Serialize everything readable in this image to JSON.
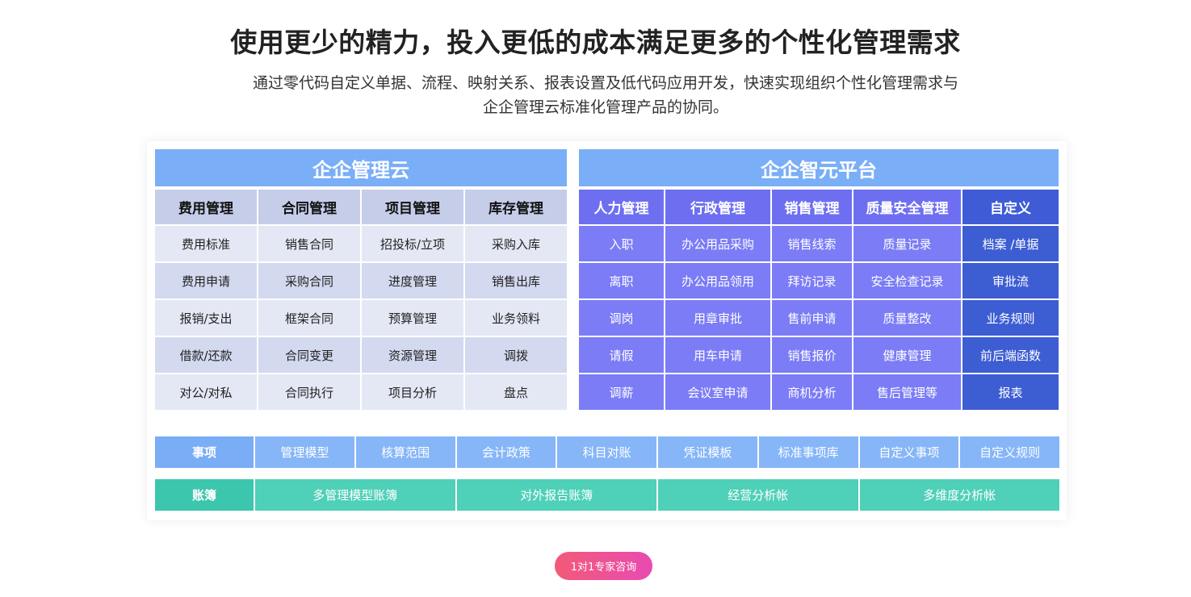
{
  "header": {
    "title": "使用更少的精力，投入更低的成本满足更多的个性化管理需求",
    "subtitle": "通过零代码自定义单据、流程、映射关系、报表设置及低代码应用开发，快速实现组织个性化管理需求与企企管理云标准化管理产品的协同。"
  },
  "left_block": {
    "title": "企企管理云",
    "columns": [
      "费用管理",
      "合同管理",
      "项目管理",
      "库存管理"
    ],
    "rows": [
      [
        "费用标准",
        "销售合同",
        "招投标/立项",
        "采购入库"
      ],
      [
        "费用申请",
        "采购合同",
        "进度管理",
        "销售出库"
      ],
      [
        "报销/支出",
        "框架合同",
        "预算管理",
        "业务领料"
      ],
      [
        "借款/还款",
        "合同变更",
        "资源管理",
        "调拨"
      ],
      [
        "对公/对私",
        "合同执行",
        "项目分析",
        "盘点"
      ]
    ]
  },
  "right_block": {
    "title": "企企智元平台",
    "columns": [
      "人力管理",
      "行政管理",
      "销售管理",
      "质量安全管理",
      "自定义"
    ],
    "rows": [
      [
        "入职",
        "办公用品采购",
        "销售线索",
        "质量记录",
        "档案 /单据"
      ],
      [
        "离职",
        "办公用品领用",
        "拜访记录",
        "安全检查记录",
        "审批流"
      ],
      [
        "调岗",
        "用章审批",
        "售前申请",
        "质量整改",
        "业务规则"
      ],
      [
        "请假",
        "用车申请",
        "销售报价",
        "健康管理",
        "前后端函数"
      ],
      [
        "调薪",
        "会议室申请",
        "商机分析",
        "售后管理等",
        "报表"
      ]
    ]
  },
  "items_row": {
    "label": "事项",
    "items": [
      "管理模型",
      "核算范围",
      "会计政策",
      "科目对账",
      "凭证模板",
      "标准事项库",
      "自定义事项",
      "自定义规则"
    ]
  },
  "ledger_row": {
    "label": "账簿",
    "items": [
      "多管理模型账簿",
      "对外报告账簿",
      "经营分析帐",
      "多维度分析帐"
    ]
  },
  "cta": {
    "label": "1对1专家咨询"
  }
}
